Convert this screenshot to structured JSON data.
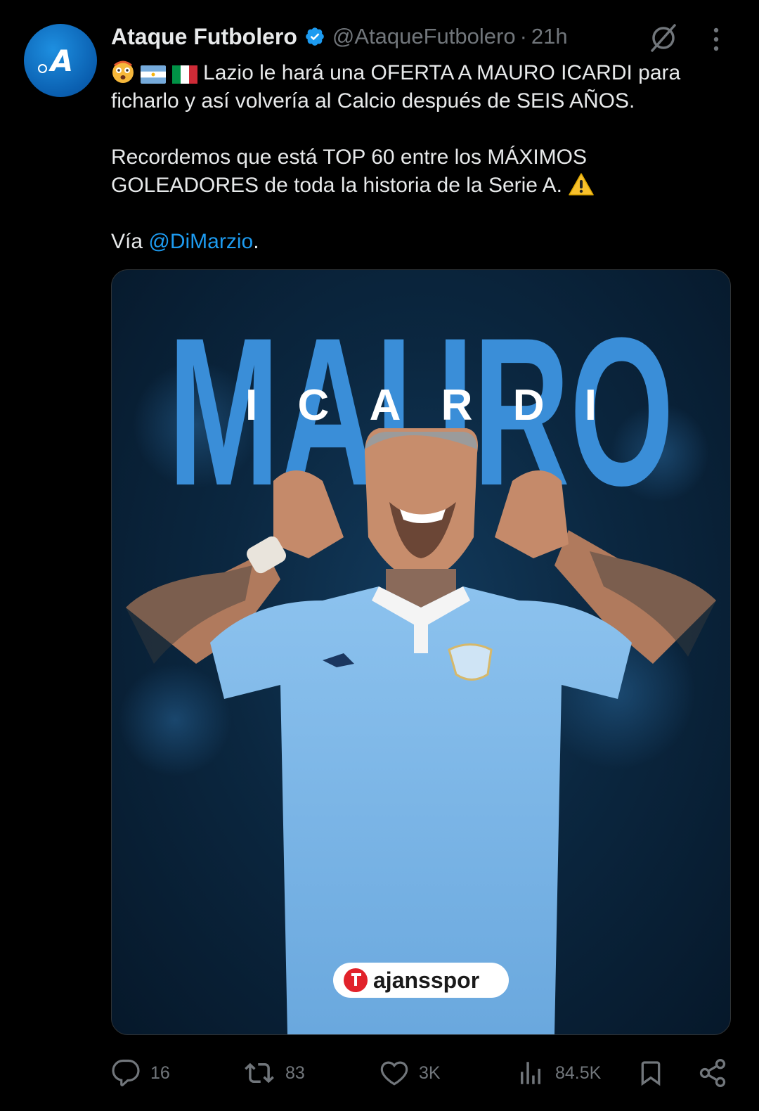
{
  "post": {
    "author_name": "Ataque Futbolero",
    "handle": "@AtaqueFutbolero",
    "separator": "·",
    "time": "21h",
    "avatar_text": "A",
    "line1_text": "Lazio le hará una OFERTA A MAURO ICARDI para",
    "line2_text": "ficharlo y así volvería al Calcio después de SEIS AÑOS.",
    "para2_line1": "Recordemos que está TOP 60 entre los MÁXIMOS",
    "para2_line2": "GOLEADORES de toda la historia de la Serie A.",
    "via_label": "Vía",
    "via_mention": "@DiMarzio",
    "via_suffix": "."
  },
  "media": {
    "big_name": "MAURO",
    "overlay_name": "ICARDI",
    "watermark": "ajansspor",
    "colors": {
      "big_letters": "#3a8ed8",
      "shirt": "#7db6e6"
    }
  },
  "actions": {
    "replies": "16",
    "reposts": "83",
    "likes": "3K",
    "views": "84.5K"
  },
  "colors": {
    "accent": "#1d9bf0",
    "muted": "#71767b",
    "text": "#e7e9ea",
    "background": "#000000"
  }
}
